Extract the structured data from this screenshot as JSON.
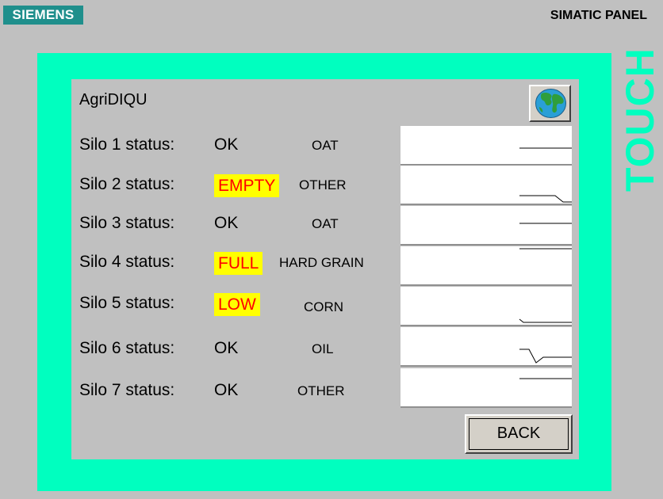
{
  "header": {
    "brand": "SIEMENS",
    "panel_title": "SIMATIC PANEL",
    "side_label": "TOUCH"
  },
  "colors": {
    "bezel": "#00ffbf",
    "screen": "#c0c0c0",
    "warning_bg": "#ffff00",
    "warning_text": "#ff0000",
    "brand_bg": "#1f8f8c"
  },
  "screen": {
    "title": "AgriDIQU",
    "globe_icon": "globe-icon",
    "back_label": "BACK",
    "silos": [
      {
        "label": "Silo 1 status:",
        "status": "OK",
        "grain": "OAT",
        "alert": false
      },
      {
        "label": "Silo 2 status:",
        "status": "EMPTY",
        "grain": "OTHER",
        "alert": true
      },
      {
        "label": "Silo 3 status:",
        "status": "OK",
        "grain": "OAT",
        "alert": false
      },
      {
        "label": "Silo 4 status:",
        "status": "FULL",
        "grain": "HARD GRAIN",
        "alert": true
      },
      {
        "label": "Silo 5 status:",
        "status": "LOW",
        "grain": "CORN",
        "alert": true
      },
      {
        "label": "Silo 6 status:",
        "status": "OK",
        "grain": "OIL",
        "alert": false
      },
      {
        "label": "Silo 7 status:",
        "status": "OK",
        "grain": "OTHER",
        "alert": false
      }
    ]
  }
}
